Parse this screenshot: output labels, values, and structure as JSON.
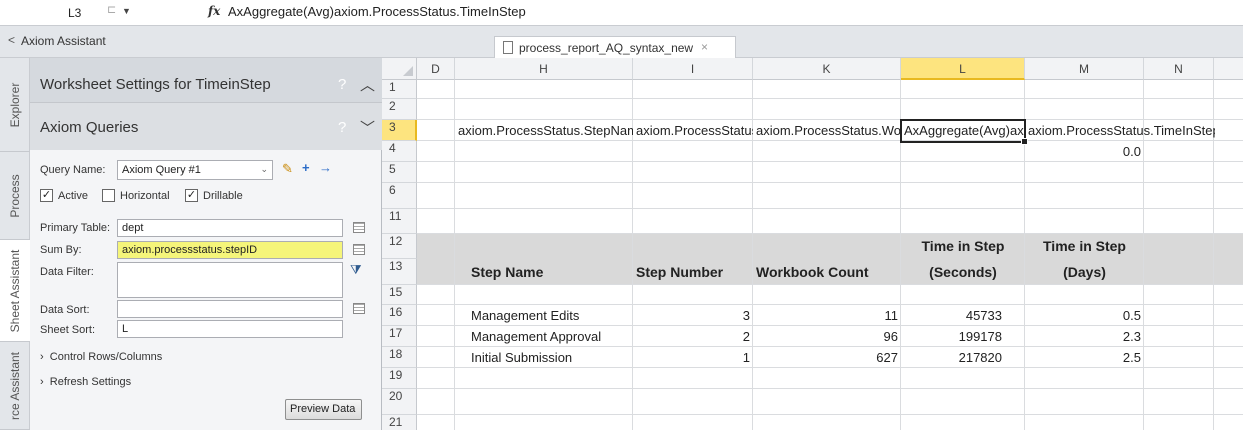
{
  "formula_bar": {
    "name_box": "L3",
    "fx": "fx",
    "formula": "AxAggregate(Avg)axiom.ProcessStatus.TimeInStep"
  },
  "pane": {
    "title": "Axiom Assistant",
    "vertical_tabs": [
      "Explorer",
      "Process",
      "Sheet Assistant",
      "rce Assistant"
    ],
    "worksheet_settings_title": "Worksheet Settings for TimeinStep",
    "axiom_queries_title": "Axiom Queries",
    "help_glyph": "?",
    "query_name_label": "Query Name:",
    "query_name_value": "Axiom Query #1",
    "checkbox_active": "Active",
    "checkbox_horizontal": "Horizontal",
    "checkbox_drillable": "Drillable",
    "primary_table_label": "Primary Table:",
    "primary_table_value": "dept",
    "sum_by_label": "Sum By:",
    "sum_by_value": "axiom.processstatus.stepID",
    "data_filter_label": "Data Filter:",
    "data_sort_label": "Data Sort:",
    "sheet_sort_label": "Sheet Sort:",
    "sheet_sort_value": "L",
    "control_rows": "Control Rows/Columns",
    "refresh_settings": "Refresh Settings",
    "preview_button": "Preview Data"
  },
  "document_tab": {
    "label": "process_report_AQ_syntax_new",
    "close": "×"
  },
  "grid": {
    "columns": [
      "D",
      "H",
      "I",
      "K",
      "L",
      "M",
      "N"
    ],
    "rows": [
      "1",
      "2",
      "3",
      "4",
      "5",
      "6",
      "11",
      "12",
      "13",
      "15",
      "16",
      "17",
      "18",
      "19",
      "20",
      "21"
    ],
    "row3": [
      "axiom.ProcessStatus.StepName",
      "axiom.ProcessStatus.StepNumber",
      "axiom.ProcessStatus.WorkbookCount",
      "AxAggregate(Avg)axiom.ProcessStatus.TimeInStep",
      "axiom.ProcessStatus.TimeInStep"
    ],
    "row4_m": "0.0",
    "header_row12": [
      "Time in Step",
      "Time in Step"
    ],
    "header_row13": [
      "Step Name",
      "Step Number",
      "Workbook Count",
      "(Seconds)",
      "(Days)"
    ],
    "data": [
      {
        "name": "Management Edits",
        "step": "3",
        "count": "11",
        "seconds": "45733",
        "days": "0.5"
      },
      {
        "name": "Management Approval",
        "step": "2",
        "count": "96",
        "seconds": "199178",
        "days": "2.3"
      },
      {
        "name": "Initial Submission",
        "step": "1",
        "count": "627",
        "seconds": "217820",
        "days": "2.5"
      }
    ]
  }
}
